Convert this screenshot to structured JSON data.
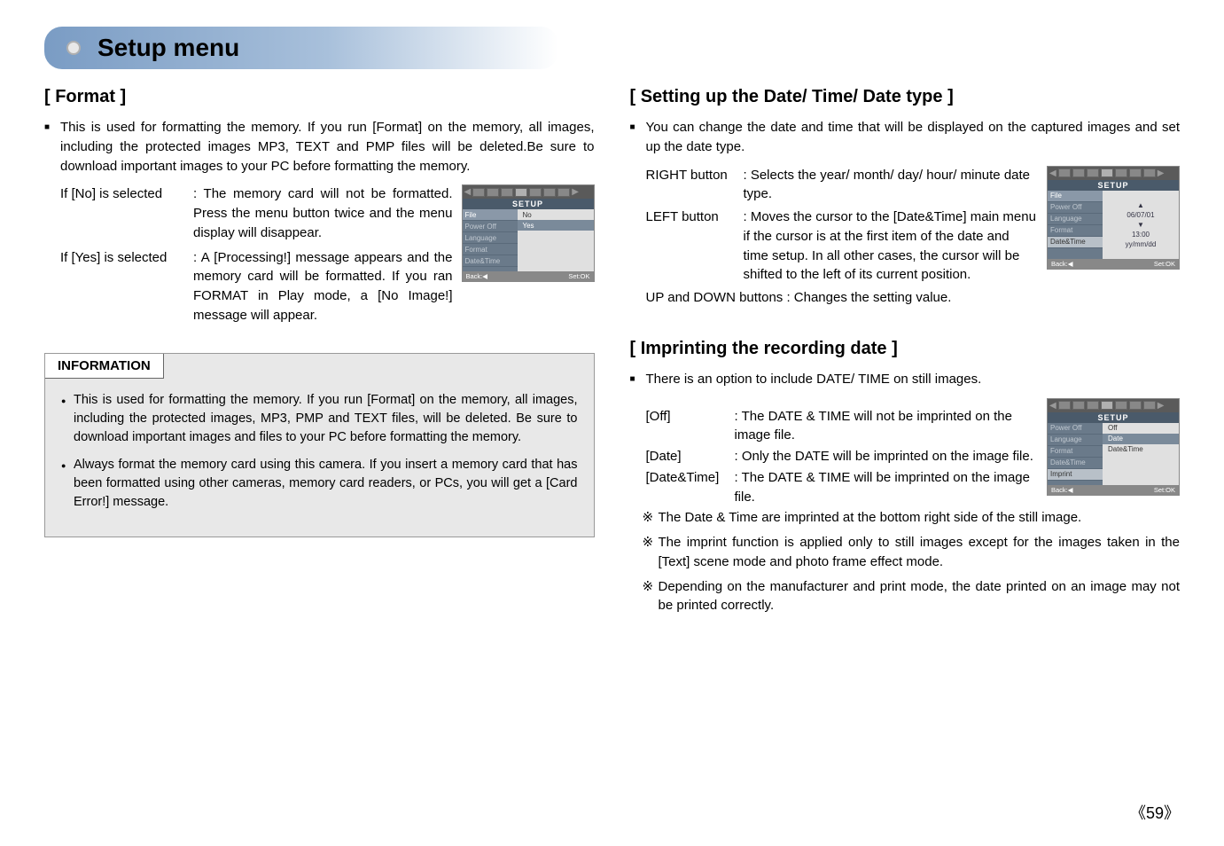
{
  "page_title": "Setup menu",
  "page_number": "《59》",
  "left": {
    "format_heading": "[ Format ]",
    "format_para": "This is used for formatting the memory. If you run [Format] on the memory, all images, including the protected images MP3, TEXT and PMP files will be deleted.Be sure to download important images to your PC before formatting the memory.",
    "no_label": "If [No] is selected",
    "no_text": ": The memory card will not be formatted. Press the menu button twice and the menu display will disappear.",
    "yes_label": "If [Yes] is selected",
    "yes_text": ": A [Processing!] message appears and the memory card will be formatted. If you ran FORMAT in Play mode, a [No Image!] message will appear.",
    "info_title": "INFORMATION",
    "info_item1": "This is used for formatting the memory. If you run [Format] on the memory, all images, including the protected images, MP3, PMP and TEXT files, will be deleted. Be sure to download important images and files to your PC before formatting the memory.",
    "info_item2": "Always format the memory card using this camera. If you insert a memory card that has been formatted using other cameras, memory card readers, or PCs, you will get a [Card Error!] message."
  },
  "right": {
    "dt_heading": "[ Setting up the Date/ Time/ Date type ]",
    "dt_para": "You can change the date and time that will be displayed on the captured images and set up the date type.",
    "right_button_label": "RIGHT button",
    "right_button_text": ": Selects the year/ month/ day/ hour/ minute date type.",
    "left_button_label": "LEFT button",
    "left_button_text": ": Moves the cursor to the [Date&Time] main menu if the cursor is at the first item of the date and time setup. In all other cases, the cursor will be shifted to the left of its current position.",
    "updown_text": "UP and DOWN buttons : Changes the setting value.",
    "imprint_heading": "[ Imprinting the recording date ]",
    "imprint_para": "There is an option to include DATE/ TIME on still images.",
    "off_label": "[Off]",
    "off_text": ": The DATE & TIME will not be imprinted on the image file.",
    "date_label": "[Date]",
    "date_text": ": Only the DATE will be imprinted on the image file.",
    "datetime_label": "[Date&Time]",
    "datetime_text": ": The DATE & TIME will be imprinted on the image file.",
    "note1": "The Date & Time are imprinted at the bottom right side of the still image.",
    "note2": "The imprint function is applied only to still images except for the images taken in the [Text] scene mode and photo frame effect mode.",
    "note3": "Depending on the manufacturer and print mode, the date printed on an image may not be printed correctly."
  },
  "lcd1": {
    "setup": "SETUP",
    "menu": {
      "file": "File",
      "poweroff": "Power Off",
      "language": "Language",
      "format": "Format",
      "datetime": "Date&Time"
    },
    "opts": {
      "no": "No",
      "yes": "Yes"
    },
    "back": "Back:◀",
    "setok": "Set:OK"
  },
  "lcd2": {
    "setup": "SETUP",
    "menu": {
      "file": "File",
      "poweroff": "Power Off",
      "language": "Language",
      "format": "Format",
      "datetime": "Date&Time"
    },
    "dt": {
      "up": "▲",
      "date": "06/07/01",
      "down": "▼",
      "time": "13:00",
      "fmt": "yy/mm/dd"
    },
    "back": "Back:◀",
    "setok": "Set:OK"
  },
  "lcd3": {
    "setup": "SETUP",
    "menu": {
      "poweroff": "Power Off",
      "language": "Language",
      "format": "Format",
      "datetime": "Date&Time",
      "imprint": "Imprint"
    },
    "opts": {
      "off": "Off",
      "date": "Date",
      "datetime": "Date&Time"
    },
    "back": "Back:◀",
    "setok": "Set:OK"
  }
}
